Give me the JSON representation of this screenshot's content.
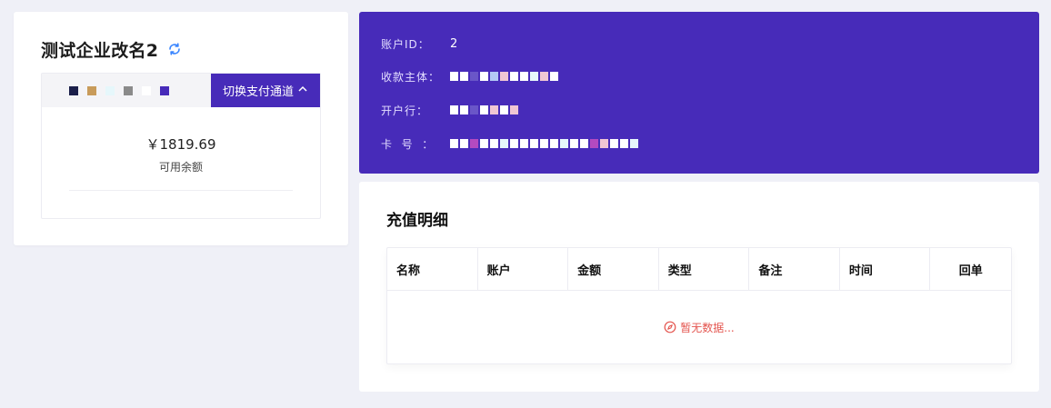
{
  "company": {
    "name": "测试企业改名2"
  },
  "payment_channel": {
    "switch_label": "切换支付通道",
    "masked_colors": [
      "#1b1f4a",
      "#c89b5a",
      "#e6f7fb",
      "#8a8a8a",
      "#ffffff",
      "#472bb9"
    ]
  },
  "balance": {
    "amount": "￥1819.69",
    "label": "可用余额"
  },
  "account": {
    "id_label": "账户ID：",
    "id_value": "2",
    "payee_label": "收款主体：",
    "bank_label": "开户行：",
    "card_label": "卡  号  ：",
    "masked_payee": [
      "#ffffff",
      "#ffffff",
      "#6a56c8",
      "#ffffff",
      "#b3c9f5",
      "#f0c6d4",
      "#ffffff",
      "#ffffff",
      "#e6f7fb",
      "#f0c6d4",
      "#ffffff"
    ],
    "masked_bank": [
      "#ffffff",
      "#ffffff",
      "#6a56c8",
      "#ffffff",
      "#f0c6d4",
      "#ffffff",
      "#f0c6d4"
    ],
    "masked_card": [
      "#ffffff",
      "#ffffff",
      "#b44ac0",
      "#ffffff",
      "#ffffff",
      "#e6f7fb",
      "#ffffff",
      "#ffffff",
      "#ffffff",
      "#ffffff",
      "#ffffff",
      "#e6f7fb",
      "#ffffff",
      "#ffffff",
      "#b44ac0",
      "#f0c6d4",
      "#ffffff",
      "#ffffff",
      "#e6f7fb"
    ]
  },
  "recharge": {
    "title": "充值明细",
    "columns": [
      "名称",
      "账户",
      "金额",
      "类型",
      "备注",
      "时间",
      "回单"
    ],
    "empty_text": "暂无数据..."
  },
  "colors": {
    "brand": "#472bb9",
    "empty_text": "#e4554f",
    "refresh_icon": "#3a86ff"
  },
  "icons": {
    "refresh": "refresh-icon",
    "chevron": "chevron-up-icon",
    "empty": "compass-icon"
  }
}
